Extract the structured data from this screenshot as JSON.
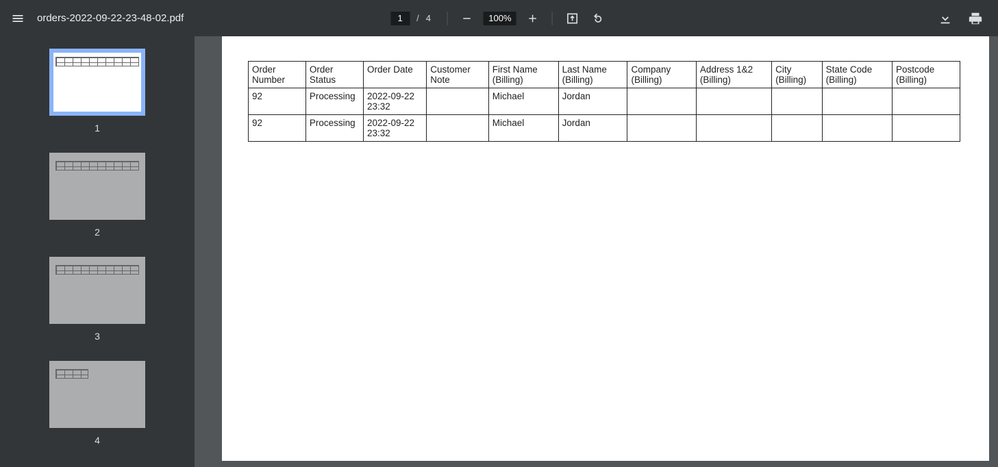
{
  "filename": "orders-2022-09-22-23-48-02.pdf",
  "page": {
    "current": "1",
    "separator": "/",
    "total": "4"
  },
  "zoom": "100%",
  "thumbnails": [
    "1",
    "2",
    "3",
    "4"
  ],
  "table": {
    "headers": [
      "Order Number",
      "Order Status",
      "Order Date",
      "Customer Note",
      "First Name (Billing)",
      "Last Name (Billing)",
      "Company (Billing)",
      "Address 1&2 (Billing)",
      "City (Billing)",
      "State Code (Billing)",
      "Postcode (Billing)"
    ],
    "rows": [
      [
        "92",
        "Processing",
        "2022-09-22 23:32",
        "",
        "Michael",
        "Jordan",
        "",
        "",
        "",
        "",
        ""
      ],
      [
        "92",
        "Processing",
        "2022-09-22 23:32",
        "",
        "Michael",
        "Jordan",
        "",
        "",
        "",
        "",
        ""
      ]
    ]
  }
}
